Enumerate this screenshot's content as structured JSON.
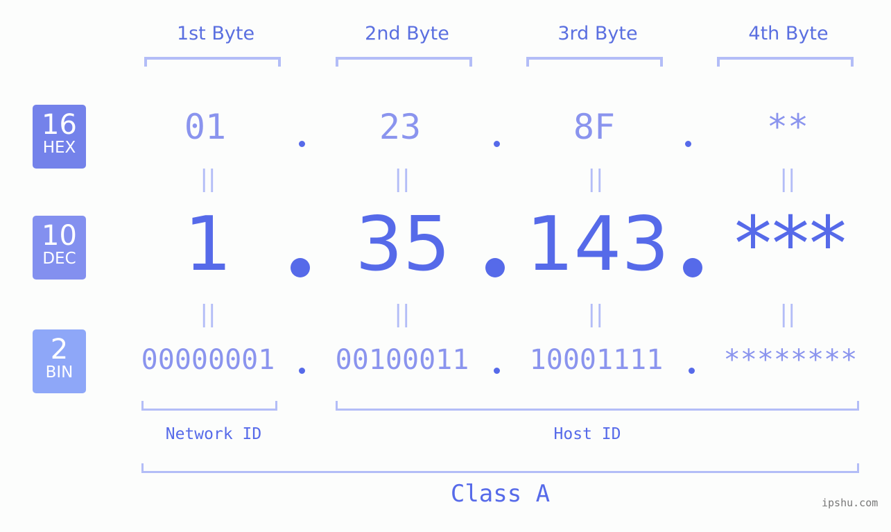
{
  "byte_headers": [
    "1st Byte",
    "2nd Byte",
    "3rd Byte",
    "4th Byte"
  ],
  "rows": [
    {
      "base": "16",
      "name": "HEX",
      "color": "#7482ea",
      "values": [
        "01",
        "23",
        "8F",
        "**"
      ]
    },
    {
      "base": "10",
      "name": "DEC",
      "color": "#8390ef",
      "values": [
        "1",
        "35",
        "143",
        "***"
      ]
    },
    {
      "base": "2",
      "name": "BIN",
      "color": "#8ea7f8",
      "values": [
        "00000001",
        "00100011",
        "10001111",
        "********"
      ]
    }
  ],
  "separator": ".",
  "equals": "||",
  "parts": {
    "network": "Network ID",
    "host": "Host ID"
  },
  "class_label": "Class A",
  "credit": "ipshu.com",
  "colors": {
    "accent": "#566ae9",
    "light": "#8a94ee",
    "bracket": "#b3bdf7"
  }
}
